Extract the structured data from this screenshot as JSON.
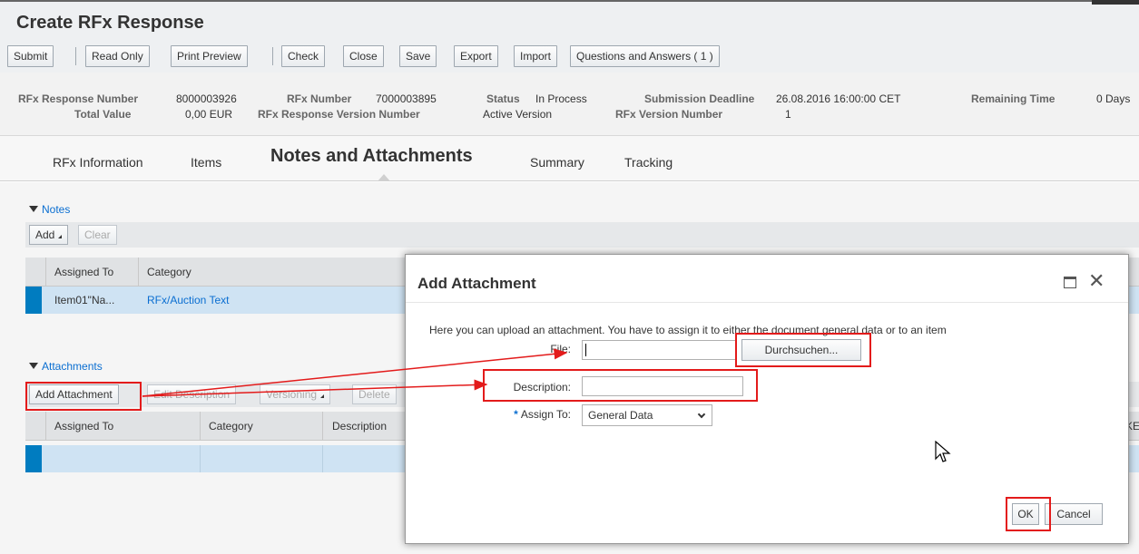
{
  "page": {
    "title": "Create RFx Response"
  },
  "toolbar": {
    "buttons": [
      "Submit",
      "Read Only",
      "Print Preview",
      "Check",
      "Close",
      "Save",
      "Export",
      "Import",
      "Questions and Answers ( 1 )"
    ]
  },
  "header": {
    "rfx_response_number_label": "RFx Response Number",
    "rfx_response_number": "8000003926",
    "total_value_label": "Total Value",
    "total_value": "0,00 EUR",
    "rfx_number_label": "RFx Number",
    "rfx_number": "7000003895",
    "rfx_response_version_label": "RFx Response Version Number",
    "rfx_response_version": "Active Version",
    "status_label": "Status",
    "status": "In Process",
    "submission_deadline_label": "Submission Deadline",
    "submission_deadline": "26.08.2016 16:00:00 CET",
    "rfx_version_label": "RFx Version Number",
    "rfx_version": "1",
    "remaining_time_label": "Remaining Time",
    "remaining_time": "0 Days"
  },
  "tabs": [
    "RFx Information",
    "Items",
    "Notes and Attachments",
    "Summary",
    "Tracking"
  ],
  "notes": {
    "title": "Notes",
    "add_label": "Add",
    "clear_label": "Clear",
    "columns": [
      "Assigned To",
      "Category"
    ],
    "row": {
      "assigned_to": "Item01\"Na...",
      "category": "RFx/Auction Text"
    }
  },
  "attachments": {
    "title": "Attachments",
    "buttons": [
      "Add Attachment",
      "Edit Description",
      "Versioning",
      "Delete"
    ],
    "columns": [
      "Assigned To",
      "Category",
      "Description"
    ],
    "cut_column": "KE"
  },
  "dialog": {
    "title": "Add Attachment",
    "instruction": "Here you can upload an attachment. You have to assign it to either the document general data or to an item",
    "file_label": "File:",
    "file_value": "",
    "browse_label": "Durchsuchen...",
    "description_label": "Description:",
    "description_value": "",
    "assign_to_label": "Assign To:",
    "assign_to_value": "General Data",
    "ok_label": "OK",
    "cancel_label": "Cancel"
  },
  "colors": {
    "link": "#0a6ed1",
    "selection": "#007cc0",
    "selected_row": "#cfe3f3",
    "highlight": "#e31b1b"
  },
  "icons": [
    "collapse-triangle-icon",
    "dropdown-triangle-icon",
    "maximize-icon",
    "close-icon",
    "chevron-down-icon",
    "mouse-cursor-icon",
    "red-arrow-annotation"
  ]
}
